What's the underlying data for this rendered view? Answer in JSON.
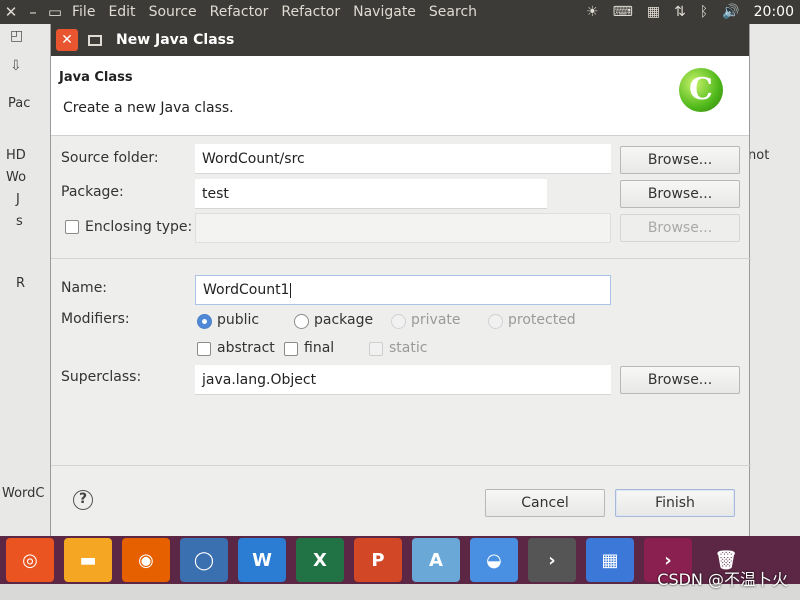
{
  "topbar": {
    "close": "✕",
    "minimize": "–",
    "maximize": "▭",
    "menu": [
      "File",
      "Edit",
      "Source",
      "Refactor",
      "Refactor",
      "Navigate",
      "Search"
    ],
    "clock": "20:00"
  },
  "eclipse": {
    "tree": [
      "Pac",
      "HD",
      "Wo",
      "J",
      "s",
      "R"
    ],
    "status": "WordC",
    "right_text": "not"
  },
  "dialog": {
    "title": "New Java Class",
    "banner": {
      "title": "Java Class",
      "description": "Create a new Java class.",
      "logo_letter": "C"
    },
    "source_folder": {
      "label": "Source folder:",
      "value": "WordCount/src",
      "button": "Browse..."
    },
    "package": {
      "label": "Package:",
      "value": "test",
      "button": "Browse..."
    },
    "enclosing": {
      "label": "Enclosing type:",
      "value": "",
      "button": "Browse..."
    },
    "name": {
      "label": "Name:",
      "value": "WordCount1"
    },
    "modifiers": {
      "label": "Modifiers:",
      "access": [
        "public",
        "package",
        "private",
        "protected"
      ],
      "selected": "public",
      "flags": [
        "abstract",
        "final",
        "static"
      ]
    },
    "superclass": {
      "label": "Superclass:",
      "value": "java.lang.Object",
      "button": "Browse..."
    },
    "help": "?",
    "cancel": "Cancel",
    "finish": "Finish"
  },
  "dock": {
    "colors": [
      "#e95420",
      "#f5a623",
      "#e66000",
      "#3a6fb0",
      "#2b7cd3",
      "#217346",
      "#d24726",
      "#6aa8d8",
      "#4a90e2",
      "#555555",
      "#3c78d8",
      "#8a2050"
    ]
  },
  "watermark": "CSDN @不温卜火"
}
